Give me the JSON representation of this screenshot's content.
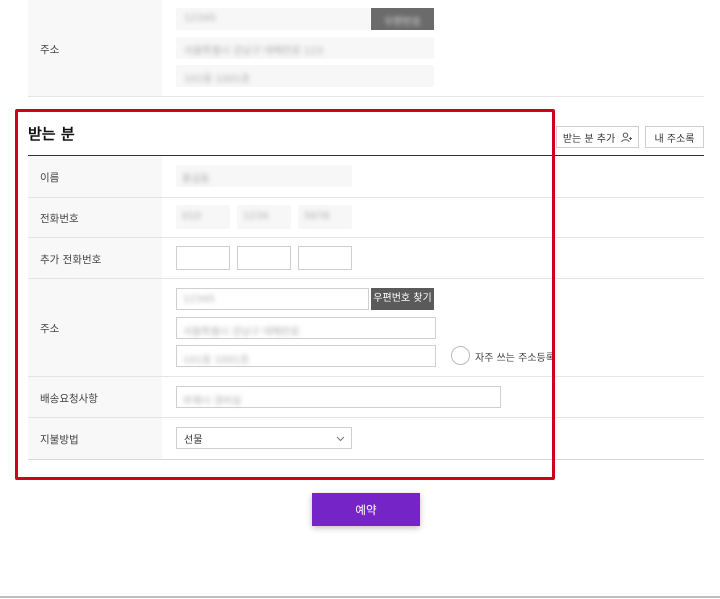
{
  "top_section": {
    "address_label": "주소",
    "address_line1_blurred": "12345",
    "address_button_blurred": "우편번호",
    "address_line2_blurred": "서울특별시 강남구 테헤란로 123",
    "address_line3_blurred": "101동 1001호"
  },
  "recipient": {
    "title": "받는 분",
    "add_recipient_label": "받는 분 추가",
    "my_address_book_label": "내 주소록",
    "name_label": "이름",
    "name_value_blurred": "홍길동",
    "phone_label": "전화번호",
    "phone_parts_blurred": [
      "010",
      "1234",
      "5678"
    ],
    "extra_phone_label": "추가 전화번호",
    "address_label": "주소",
    "zipcode_blurred": "12345",
    "zipcode_button_label": "우편번호 찾기",
    "address1_blurred": "서울특별시 강남구 테헤란로",
    "address2_blurred": "101동 1001호",
    "save_frequent_label": "자주 쓰는 주소등록",
    "delivery_request_label": "배송요청사항",
    "delivery_request_blurred": "부재시 경비실",
    "payment_label": "지불방법",
    "payment_selected": "선물"
  },
  "reserve_button_label": "예약"
}
